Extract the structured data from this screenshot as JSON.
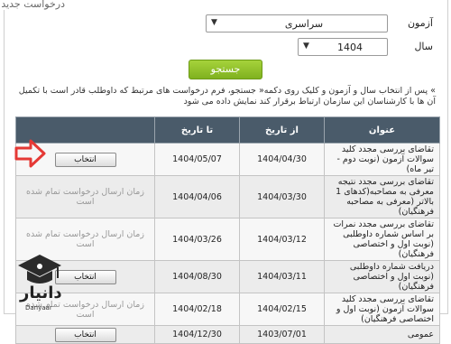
{
  "form": {
    "legend": "درخواست جدید",
    "exam_label": "آزمون",
    "exam_value": "سراسری",
    "year_label": "سال",
    "year_value": "1404",
    "search_label": "جستجو"
  },
  "note": "» پس از انتخاب سال و آزمون و کلیک روی دکمه« جستجو، فرم درخواست های مرتبط که داوطلب قادر است با تکمیل آن ها با کارشناسان این سازمان ارتباط برقرار کند نمایش داده می شود",
  "table": {
    "headers": {
      "title": "عنوان",
      "from": "از تاریخ",
      "to": "تا تاریخ",
      "action": ""
    },
    "rows": [
      {
        "title": "تقاضای بررسی مجدد کلید سوالات آزمون (نوبت دوم - تیر ماه)",
        "from": "1404/04/30",
        "to": "1404/05/07",
        "action": "انتخاب",
        "status": ""
      },
      {
        "title": "تقاضای بررسی مجدد نتیجه معرفی به مصاحبه(کدهای 1 بالاتر (معرفی به مصاحبه فرهنگیان)",
        "from": "1404/03/30",
        "to": "1404/04/06",
        "action": "",
        "status": "زمان ارسال درخواست تمام شده است"
      },
      {
        "title": "تقاضای بررسی مجدد نمرات بر اساس شماره داوطلبی (نوبت اول و اختصاصی فرهنگیان)",
        "from": "1404/03/12",
        "to": "1404/03/26",
        "action": "",
        "status": "زمان ارسال درخواست تمام شده است"
      },
      {
        "title": "دریافت شماره داوطلبی (نوبت اول و اختصاصی فرهنگیان)",
        "from": "1404/03/11",
        "to": "1404/08/30",
        "action": "انتخاب",
        "status": ""
      },
      {
        "title": "تقاضای بررسی مجدد کلید سوالات آزمون (نوبت اول و اختصاصی فرهنگیان)",
        "from": "1404/02/15",
        "to": "1404/02/18",
        "action": "",
        "status": "زمان ارسال درخواست تمام شده است"
      },
      {
        "title": "عمومی",
        "from": "1403/07/01",
        "to": "1404/12/30",
        "action": "انتخاب",
        "status": ""
      }
    ]
  },
  "watermark": {
    "name": "دانیار",
    "sub": "Danyaar"
  },
  "colors": {
    "header": "#4a5b6a",
    "search_button": "#8cc12b",
    "arrow": "#e53935"
  }
}
